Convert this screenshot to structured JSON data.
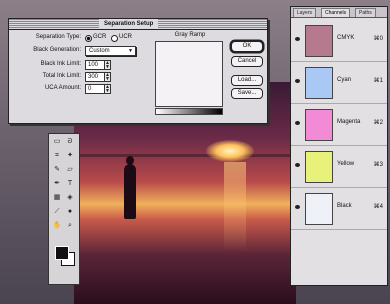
{
  "dialog": {
    "title": "Separation Setup",
    "fields": [
      {
        "label": "Separation Type:",
        "kind": "radio",
        "options": [
          "GCR",
          "UCR"
        ],
        "selected": 0
      },
      {
        "label": "Black Generation:",
        "kind": "select",
        "value": "Custom"
      },
      {
        "label": "Black Ink Limit:",
        "kind": "number",
        "value": "100"
      },
      {
        "label": "Total Ink Limit:",
        "kind": "number",
        "value": "300"
      },
      {
        "label": "UCA Amount:",
        "kind": "number",
        "value": "0"
      }
    ],
    "ramp_title": "Gray Ramp",
    "buttons": [
      "OK",
      "Cancel",
      "Load...",
      "Save..."
    ]
  },
  "palette": {
    "tabs": [
      "Layers",
      "Channels",
      "Paths"
    ],
    "active_tab": 1,
    "channels": [
      {
        "name": "CMYK",
        "key": "⌘0",
        "color": "#b67a8e"
      },
      {
        "name": "Cyan",
        "key": "⌘1",
        "color": "#a9c9f4"
      },
      {
        "name": "Magenta",
        "key": "⌘2",
        "color": "#f28ad6"
      },
      {
        "name": "Yellow",
        "key": "⌘3",
        "color": "#e8f27a"
      },
      {
        "name": "Black",
        "key": "⌘4",
        "color": "#eef2f8"
      }
    ]
  },
  "toolbox": {
    "tools": [
      "marquee-icon",
      "lasso-icon",
      "crop-icon",
      "wand-icon",
      "brush-icon",
      "eraser-icon",
      "pen-icon",
      "text-icon",
      "gradient-icon",
      "bucket-icon",
      "eyedropper-icon",
      "hand-icon",
      "zoom-icon",
      "blur-icon"
    ]
  }
}
